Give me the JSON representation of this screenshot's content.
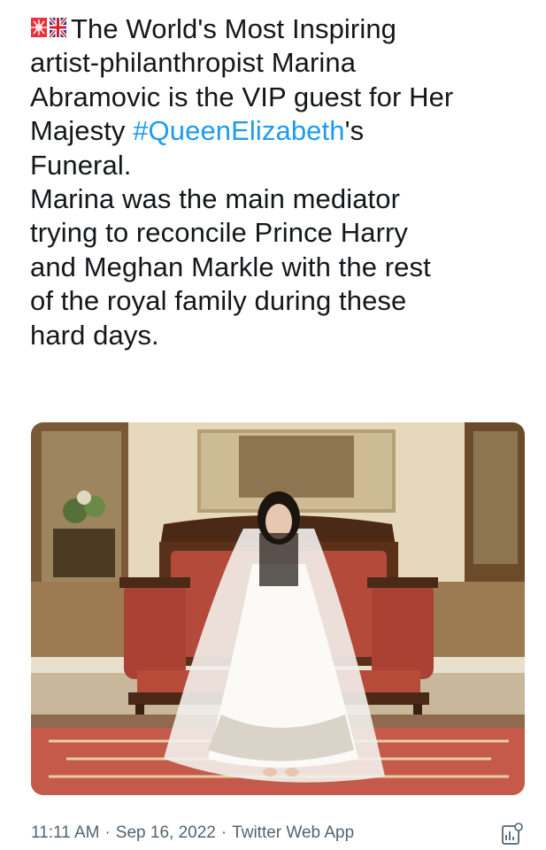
{
  "tweet": {
    "line1": "The World's Most Inspiring",
    "line2": "artist-philanthropist Marina",
    "line3": "Abramovic is the VIP guest for Her",
    "line4_before": "Majesty ",
    "hashtag": "#QueenElizabeth",
    "line4_after": "'s",
    "line5": "Funeral.",
    "line6": "Marina was the main mediator",
    "line7": "trying to reconcile Prince Harry",
    "line8": "and Meghan Markle with the rest",
    "line9": "of the royal family during these",
    "line10": "hard days."
  },
  "meta": {
    "time": "11:11 AM",
    "separator": "·",
    "date": "Sep 16, 2022",
    "source": "Twitter Web App"
  },
  "icons": {
    "flag1": "japan-flag-emoji",
    "flag2": "uk-flag-emoji",
    "analytics": "analytics-icon"
  },
  "colors": {
    "hashtag": "#1d9bf0",
    "meta_text": "#536471",
    "body_text": "#14171a"
  }
}
